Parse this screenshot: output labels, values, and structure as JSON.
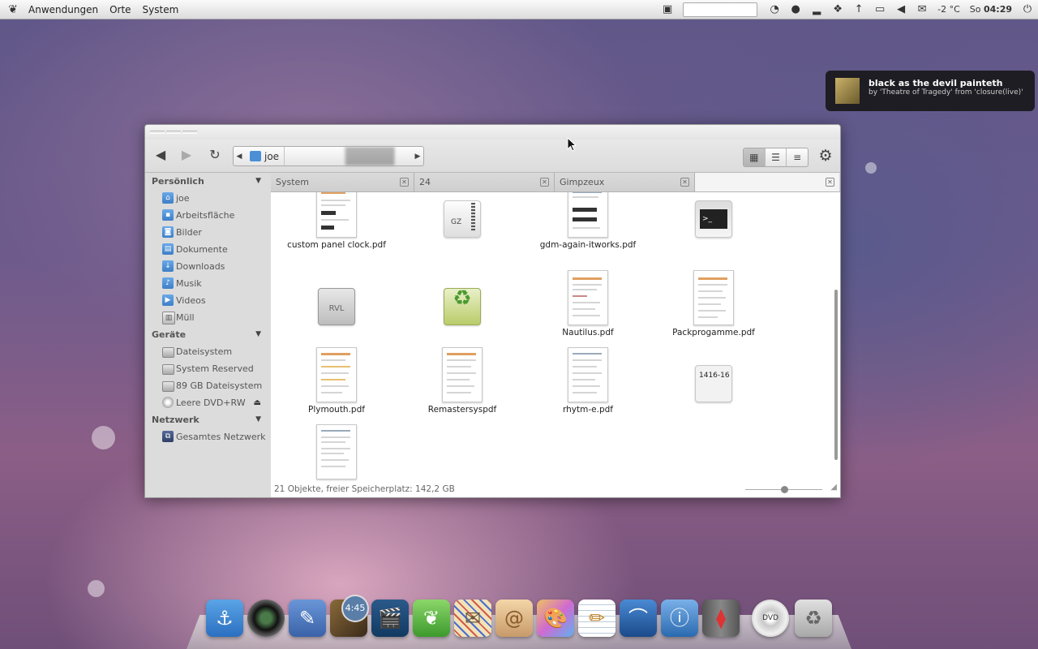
{
  "topbar": {
    "menus": [
      "Anwendungen",
      "Orte",
      "System"
    ],
    "temperature": "-2 °C",
    "day": "So",
    "time": "04:29"
  },
  "notification": {
    "title": "black as the devil painteth",
    "body": "by 'Theatre of Tragedy' from 'closure(live)'"
  },
  "window": {
    "path": {
      "home_label": "joe"
    },
    "sidebar": {
      "sections": [
        {
          "title": "Persönlich",
          "items": [
            "joe",
            "Arbeitsfläche",
            "Bilder",
            "Dokumente",
            "Downloads",
            "Musik",
            "Videos",
            "Müll"
          ]
        },
        {
          "title": "Geräte",
          "items": [
            "Dateisystem",
            "System Reserved",
            "89 GB Dateisystem",
            "Leere DVD+RW"
          ]
        },
        {
          "title": "Netzwerk",
          "items": [
            "Gesamtes Netzwerk"
          ]
        }
      ]
    },
    "tabs": [
      "System",
      "24",
      "Gimpzeux"
    ],
    "files": [
      {
        "label": "custom panel clock.pdf"
      },
      {
        "label": ""
      },
      {
        "label": "gdm-again-itworks.pdf"
      },
      {
        "label": ""
      },
      {
        "label": ""
      },
      {
        "label": ""
      },
      {
        "label": "Nautilus.pdf"
      },
      {
        "label": "Packprogamme.pdf"
      },
      {
        "label": "Plymouth.pdf"
      },
      {
        "label": "Remastersyspdf"
      },
      {
        "label": "rhytm-e.pdf"
      },
      {
        "label": ""
      },
      {
        "label": ""
      }
    ],
    "icon_text": {
      "gz": "GZ",
      "rvl": "RVL",
      "text_file": "1416-16"
    },
    "status": "21 Objekte, freier Speicherplatz: 142,2 GB"
  },
  "dock": {
    "clock_label": "4:45",
    "icons": [
      "anchor-icon",
      "camera-icon",
      "pen-icon",
      "photo-clock-icon",
      "clapper-icon",
      "leaf-icon",
      "mail-icon",
      "shell-icon",
      "paint-icon",
      "notepad-icon",
      "network-icon",
      "info-icon",
      "suit-icon",
      "dvd-icon",
      "trash-icon"
    ]
  }
}
